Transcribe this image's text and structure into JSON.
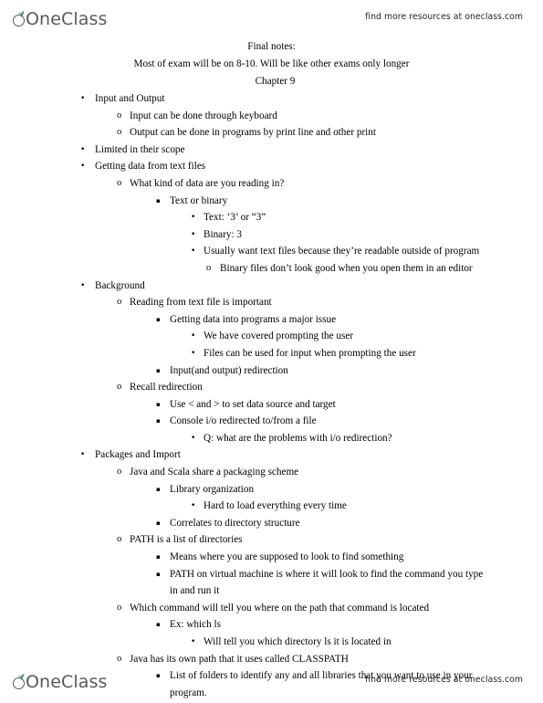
{
  "brand": {
    "name": "OneClass",
    "tagline": "find more resources at oneclass.com",
    "logo_color": "#58595b",
    "leaf_color": "#2e8b57"
  },
  "document": {
    "title": "Final notes:",
    "subtitle": "Most of exam will be on 8-10. Will be like other exams only longer",
    "chapter": "Chapter 9",
    "outline": [
      {
        "level": 1,
        "marker": "bullet-disc",
        "text": "Input and Output"
      },
      {
        "level": 2,
        "marker": "bullet-circle",
        "text": "Input can be done through keyboard"
      },
      {
        "level": 2,
        "marker": "bullet-circle",
        "text": "Output can be done in programs by print line and other print"
      },
      {
        "level": 1,
        "marker": "bullet-disc",
        "text": "Limited in their scope"
      },
      {
        "level": 1,
        "marker": "bullet-disc",
        "text": "Getting data from text files"
      },
      {
        "level": 2,
        "marker": "bullet-circle",
        "text": "What kind of data are you reading in?"
      },
      {
        "level": 3,
        "marker": "bullet-square",
        "text": "Text or binary"
      },
      {
        "level": 4,
        "marker": "bullet-disc",
        "text": "Text: ‘3’ or “3”"
      },
      {
        "level": 4,
        "marker": "bullet-disc",
        "text": "Binary: 3"
      },
      {
        "level": 4,
        "marker": "bullet-disc",
        "text": "Usually want text files because they’re readable outside of program"
      },
      {
        "level": 5,
        "marker": "bullet-circle",
        "text": "Binary files don’t look good when you open them in an editor"
      },
      {
        "level": 1,
        "marker": "bullet-disc",
        "text": "Background"
      },
      {
        "level": 2,
        "marker": "bullet-circle",
        "text": "Reading from text file is important"
      },
      {
        "level": 3,
        "marker": "bullet-square",
        "text": "Getting data into programs a major issue"
      },
      {
        "level": 4,
        "marker": "bullet-disc",
        "text": "We have covered prompting the user"
      },
      {
        "level": 4,
        "marker": "bullet-disc",
        "text": "Files can be used for input when prompting the user"
      },
      {
        "level": 3,
        "marker": "bullet-square",
        "text": "Input(and output) redirection"
      },
      {
        "level": 2,
        "marker": "bullet-circle",
        "text": "Recall redirection"
      },
      {
        "level": 3,
        "marker": "bullet-square",
        "text": "Use < and > to set data source and target"
      },
      {
        "level": 3,
        "marker": "bullet-square",
        "text": "Console i/o redirected to/from a file"
      },
      {
        "level": 4,
        "marker": "bullet-disc",
        "text": "Q: what are the problems with i/o redirection?"
      },
      {
        "level": 1,
        "marker": "bullet-disc",
        "text": "Packages and Import"
      },
      {
        "level": 2,
        "marker": "bullet-circle",
        "text": "Java and Scala share a packaging scheme"
      },
      {
        "level": 3,
        "marker": "bullet-square",
        "text": "Library organization"
      },
      {
        "level": 4,
        "marker": "bullet-disc",
        "text": "Hard to load everything every time"
      },
      {
        "level": 3,
        "marker": "bullet-square",
        "text": "Correlates to directory structure"
      },
      {
        "level": 2,
        "marker": "bullet-circle",
        "text": "PATH is a list of directories"
      },
      {
        "level": 3,
        "marker": "bullet-square",
        "text": "Means where you are supposed to look to find something"
      },
      {
        "level": 3,
        "marker": "bullet-square",
        "text": "PATH on virtual machine is where it will look to find the command you type in and run it"
      },
      {
        "level": 2,
        "marker": "bullet-circle",
        "text": "Which command will tell you where on the path that command is located"
      },
      {
        "level": 3,
        "marker": "bullet-square",
        "text": "Ex: which ls"
      },
      {
        "level": 4,
        "marker": "bullet-disc",
        "text": "Will tell you which directory ls it is located in"
      },
      {
        "level": 2,
        "marker": "bullet-circle",
        "text": "Java has its own path that it uses called CLASSPATH"
      },
      {
        "level": 3,
        "marker": "bullet-square",
        "text": "List of folders to identify any and all libraries that you want to use in your program."
      }
    ]
  },
  "markers": {
    "bullet-disc": "•",
    "bullet-circle": "o",
    "bullet-square": "▪"
  }
}
